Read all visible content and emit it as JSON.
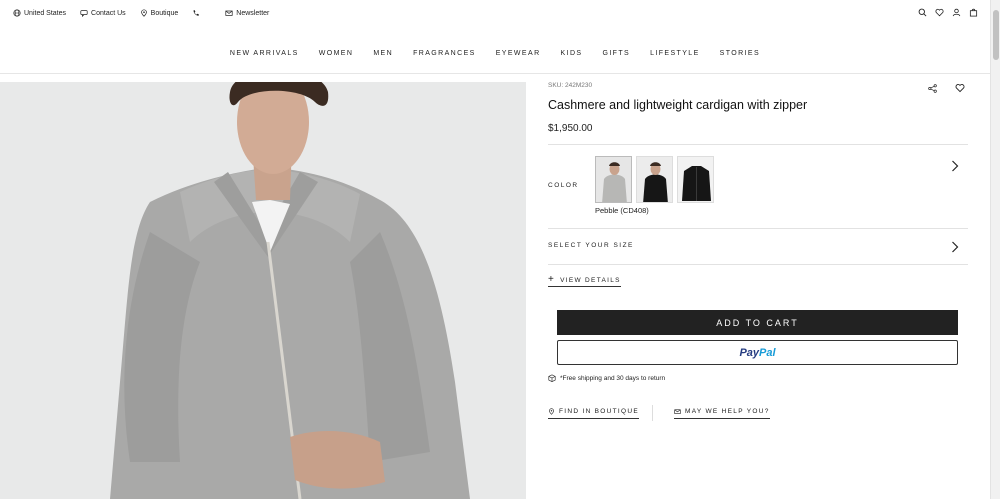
{
  "topbar": {
    "country": "United States",
    "contact": "Contact Us",
    "boutique": "Boutique",
    "newsletter": "Newsletter"
  },
  "nav": {
    "items": [
      "NEW ARRIVALS",
      "WOMEN",
      "MEN",
      "FRAGRANCES",
      "EYEWEAR",
      "KIDS",
      "GIFTS",
      "LIFESTYLE",
      "STORIES"
    ]
  },
  "product": {
    "sku": "SKU: 242M230",
    "title": "Cashmere and lightweight cardigan with zipper",
    "price": "$1,950.00",
    "color_label": "COLOR",
    "selected_color": "Pebble (CD408)",
    "size_label": "SELECT YOUR SIZE",
    "view_details": "VIEW DETAILS",
    "add_to_cart": "ADD TO CART",
    "paypal_1": "Pay",
    "paypal_2": "Pal",
    "shipping": "*Free shipping and 30 days to return",
    "find_boutique": "FIND IN BOUTIQUE",
    "help": "MAY WE HELP YOU?"
  },
  "colors": {
    "pebble": "#b7b7b5",
    "black": "#161616",
    "brand_blue": "#253b80",
    "brand_light": "#179bd7"
  }
}
